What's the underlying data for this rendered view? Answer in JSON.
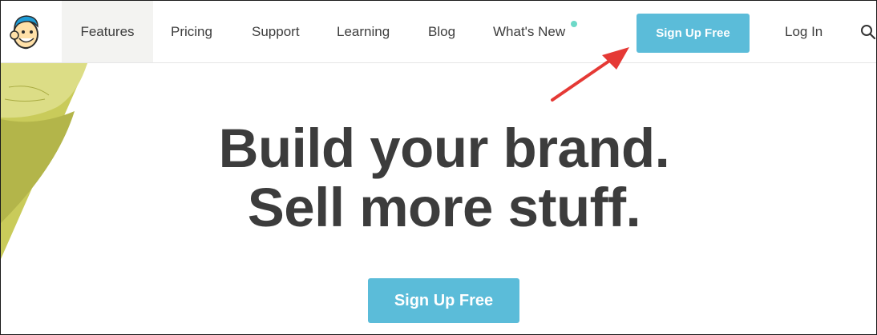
{
  "nav": {
    "items": [
      {
        "label": "Features"
      },
      {
        "label": "Pricing"
      },
      {
        "label": "Support"
      },
      {
        "label": "Learning"
      },
      {
        "label": "Blog"
      },
      {
        "label": "What's New"
      }
    ],
    "signup_label": "Sign Up Free",
    "login_label": "Log In",
    "new_indicator_color": "#6dd9c8",
    "search_icon": "search-icon",
    "logo_icon": "mailchimp-freddie-logo"
  },
  "hero": {
    "headline_line1": "Build your brand.",
    "headline_line2": "Sell more stuff.",
    "cta_label": "Sign Up Free"
  },
  "annotation": {
    "arrow_color": "#e53935",
    "arrow_icon": "red-arrow-icon"
  },
  "colors": {
    "accent": "#5bbcd9",
    "text": "#3c3c3c",
    "leaf": "#c7c957"
  }
}
